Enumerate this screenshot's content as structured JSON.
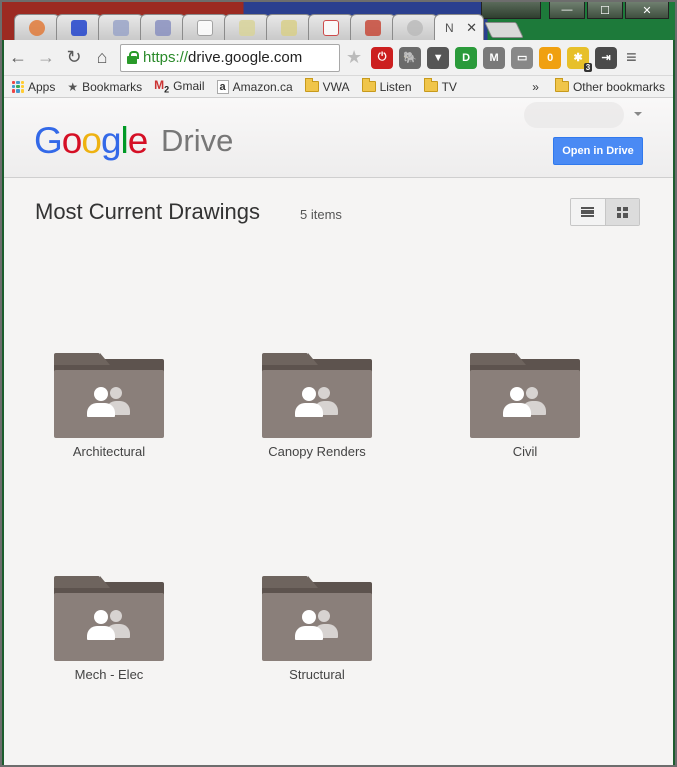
{
  "browser": {
    "active_tab_title": "N",
    "tab_close_glyph": "✕",
    "url_scheme": "https://",
    "url_rest": "drive.google.com",
    "window_controls": {
      "minimize": "—",
      "maximize": "☐",
      "close": "✕"
    },
    "extensions": [
      {
        "name": "ublock-icon",
        "color": "#cc1f1f",
        "glyph": "⏻"
      },
      {
        "name": "evernote-icon",
        "color": "#6b6b6b",
        "glyph": "🐘"
      },
      {
        "name": "pocket-icon",
        "color": "#555555",
        "glyph": "▼"
      },
      {
        "name": "ext-green-icon",
        "color": "#2a9a3a",
        "glyph": "D"
      },
      {
        "name": "ext-m-icon",
        "color": "#7a7a7a",
        "glyph": "M"
      },
      {
        "name": "cast-icon",
        "color": "#888888",
        "glyph": "▭"
      },
      {
        "name": "ext-zero-icon",
        "color": "#f0a010",
        "glyph": "0"
      },
      {
        "name": "ext-puzzle-icon",
        "color": "#e7c02a",
        "glyph": "✱",
        "badge": "3"
      },
      {
        "name": "ext-share-icon",
        "color": "#4a4a4a",
        "glyph": "⇥"
      }
    ]
  },
  "bookmarks": {
    "apps": "Apps",
    "bookmarks": "Bookmarks",
    "gmail": "Gmail",
    "gmail_badge": "2",
    "amazon": "Amazon.ca",
    "folders": [
      "VWA",
      "Listen",
      "TV"
    ],
    "overflow": "»",
    "other": "Other bookmarks"
  },
  "drive": {
    "logo_letters": [
      "G",
      "o",
      "o",
      "g",
      "l",
      "e"
    ],
    "logo_product": "Drive",
    "open_button": "Open in Drive",
    "title": "Most Current Drawings",
    "item_count": "5 items",
    "folders": [
      "Architectural",
      "Canopy Renders",
      "Civil",
      "Mech - Elec",
      "Structural"
    ]
  }
}
